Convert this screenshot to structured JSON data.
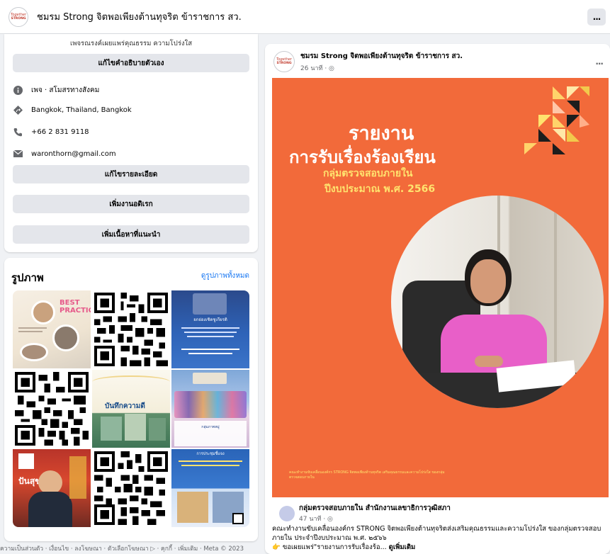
{
  "header": {
    "page_title": "ชมรม Strong จิตพอเพียงต้านทุจริต ข้าราชการ สว.",
    "logo_line1": "Together",
    "logo_line2": "STRONG",
    "more_label": "..."
  },
  "intro": {
    "bio": "เพจรณรงค์เผยแพร่คุณธรรม ความโปร่งใส",
    "edit_bio_label": "แก้ไขคำอธิบายตัวเอง",
    "category": "เพจ · สโมสรทางสังคม",
    "location": "Bangkok, Thailand, Bangkok",
    "phone": "+66 2 831 9118",
    "email": "waronthorn@gmail.com",
    "edit_details_label": "แก้ไขรายละเอียด",
    "add_hobbies_label": "เพิ่มงานอดิเรก",
    "add_featured_label": "เพิ่มเนื้อหาที่แนะนำ"
  },
  "photos": {
    "title": "รูปภาพ",
    "see_all_label": "ดูรูปภาพทั้งหมด",
    "tiles": [
      {
        "label": "BEST PRACTICE"
      },
      {
        "label": "qr"
      },
      {
        "label": "ยกย่องเชิดชูเกียรติ"
      },
      {
        "label": "qr"
      },
      {
        "label": "บันทึกความดี"
      },
      {
        "label": "กลุ่มภาพหมู่"
      },
      {
        "label": "ปันสุข"
      },
      {
        "label": "qr"
      },
      {
        "label": "การประชุมชี้แจง"
      }
    ]
  },
  "footer": {
    "text": "ความเป็นส่วนตัว · เงื่อนไข · ลงโฆษณา · ตัวเลือกโฆษณา ▷ · คุกกี้ · เพิ่มเติม · Meta © 2023"
  },
  "post": {
    "author": "ชมรม Strong จิตพอเพียงต้านทุจริต ข้าราชการ สว.",
    "time": "26 นาที · ◎",
    "more_label": "...",
    "image": {
      "title_line1": "รายงาน",
      "title_line2": "การรับเรื่องร้องเรียน",
      "subtitle_line1": "กลุ่มตรวจสอบภายใน",
      "subtitle_line2": "ปีงบประมาณ พ.ศ. 2566",
      "caption": "คณะทำงานขับเคลื่อนองค์กร STRONG จิตพอเพียงต้านทุจริต เสริมคุณธรรมและความโปร่งใส ของกลุ่มตรวจสอบภายใน"
    },
    "shared_name": "กลุ่มตรวจสอบภายใน สำนักงานเลขาธิการวุฒิสภา",
    "shared_time": "47 นาที · ◎",
    "text": "คณะทำงานขับเคลื่อนองค์กร STRONG จิตพอเพียงต้านทุจริตส่งเสริมคุณธรรมและความโปร่งใส ของกลุ่มตรวจสอบภายใน ประจำปีงบประมาณ พ.ศ. ๒๕๖๖",
    "text_line2": "👉 ขอเผยแพร่\"รายงานการรับเรื่องร้อ...",
    "see_more": "ดูเพิ่มเติม"
  },
  "colors": {
    "accent": "#1877f2",
    "orange": "#f26a3a",
    "yellow": "#ffe36e",
    "button_grey": "#e4e6eb"
  }
}
